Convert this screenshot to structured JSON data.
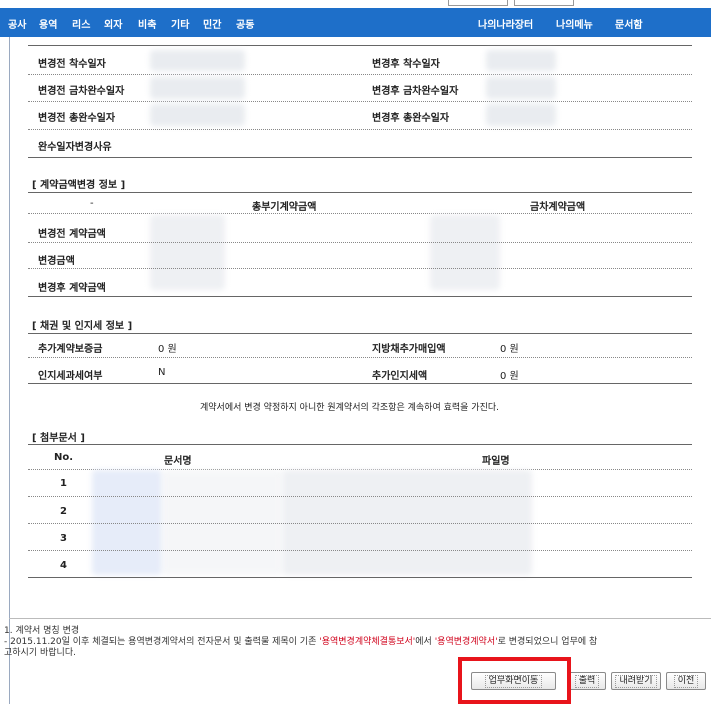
{
  "nav": {
    "items": [
      "공사",
      "용역",
      "리스",
      "외자",
      "비축",
      "기타",
      "민간",
      "공동"
    ],
    "right_items": [
      "나의나라장터",
      "나의메뉴",
      "문서함"
    ]
  },
  "dates": {
    "before_start": "변경전 착수일자",
    "after_start": "변경후 착수일자",
    "before_partial": "변경전 금차완수일자",
    "after_partial": "변경후 금차완수일자",
    "before_total": "변경전 총완수일자",
    "after_total": "변경후 총완수일자",
    "reason": "완수일자변경사유"
  },
  "amount_section": {
    "title": "[ 계약금액변경 정보 ]",
    "col_dash": "-",
    "col_total": "총부기계약금액",
    "col_current": "금차계약금액",
    "rows": [
      "변경전 계약금액",
      "변경금액",
      "변경후 계약금액"
    ]
  },
  "bond_section": {
    "title": "[ 채권 및 인지세 정보 ]",
    "deposit_label": "추가계약보증금",
    "deposit_value": "0 원",
    "local_bond_label": "지방채추가매입액",
    "local_bond_value": "0 원",
    "stamp_label": "인지세과세여부",
    "stamp_value": "N",
    "stamp_amount_label": "추가인지세액",
    "stamp_amount_value": "0 원"
  },
  "statement": "계약서에서 변경 약정하지 아니한 원계약서의 각조항은 계속하여 효력을 가진다.",
  "attach_section": {
    "title": "[ 첨부문서 ]",
    "col_no": "No.",
    "col_name": "문서명",
    "col_file": "파일명",
    "rows": [
      "1",
      "2",
      "3",
      "4"
    ]
  },
  "notes": {
    "line1": "1. 계약서 명칭 변경",
    "line2a": " - 2015.11.20일 이후 체결되는 용역변경계약서의 전자문서 및 출력물 제목이 기존 ",
    "red1": "'용역변경계약체결통보서'",
    "line2b": "에서 ",
    "red2": "'용역변경계약서'",
    "line2c": "로 변경되었으니 업무에 참",
    "line3": "고하시기 바랍니다."
  },
  "buttons": {
    "move": "업무화면이동",
    "print": "출력",
    "download": "내려받기",
    "prev": "이전"
  },
  "colors": {
    "nav": "#1e6fc9",
    "highlight": "#e8141b",
    "note_red": "#d0021b"
  }
}
